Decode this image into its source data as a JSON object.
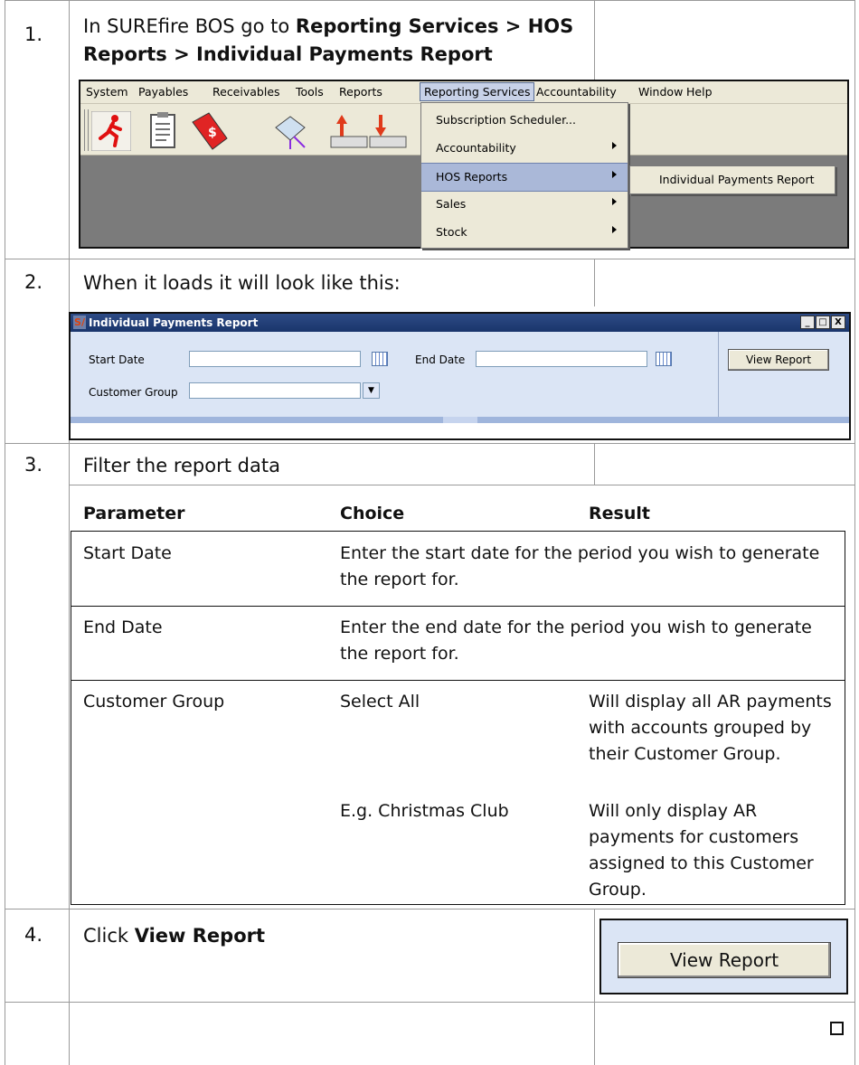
{
  "steps": [
    {
      "num": "1.",
      "text_pre": "In SUREfire BOS go to ",
      "text_bold": "Reporting Services > HOS Reports > Individual Payments Report"
    },
    {
      "num": "2.",
      "text": "When it loads it will look like this:"
    },
    {
      "num": "3.",
      "text": "Filter the report data"
    },
    {
      "num": "4.",
      "text_pre": "Click ",
      "text_bold": "View Report"
    }
  ],
  "menubar": {
    "items": [
      "System",
      "Payables",
      "Receivables",
      "Tools",
      "Reports",
      "Reporting Services",
      "Accountability",
      "Window",
      "Help"
    ]
  },
  "dropdown": {
    "items": [
      "Subscription Scheduler...",
      "Accountability",
      "HOS Reports",
      "Sales",
      "Stock"
    ],
    "highlighted": "HOS Reports",
    "submenu_item": "Individual Payments Report"
  },
  "report_window": {
    "title": "Individual Payments Report",
    "logo": "S/",
    "start_date_label": "Start Date",
    "end_date_label": "End Date",
    "customer_group_label": "Customer Group",
    "view_report_label": "View Report",
    "win_buttons": [
      "_",
      "□",
      "X"
    ]
  },
  "filter_table": {
    "headers": [
      "Parameter",
      "Choice",
      "Result"
    ],
    "rows": [
      {
        "parameter": "Start Date",
        "choice": "Enter the start date for the period you wish to generate the report for.",
        "result": ""
      },
      {
        "parameter": "End Date",
        "choice": "Enter the end date for the period you wish to generate the report for.",
        "result": ""
      },
      {
        "parameter": "Customer Group",
        "choice": "Select All",
        "result": "Will display all AR payments with accounts grouped by their Customer Group."
      },
      {
        "parameter": "",
        "choice": "E.g. Christmas Club",
        "result": "Will only display AR payments for customers assigned to this Customer Group."
      }
    ]
  },
  "step4_button": "View Report",
  "colors": {
    "menu_highlight": "#aab8d8",
    "form_bg": "#dbe5f5",
    "titlebar": "#1a356b"
  }
}
